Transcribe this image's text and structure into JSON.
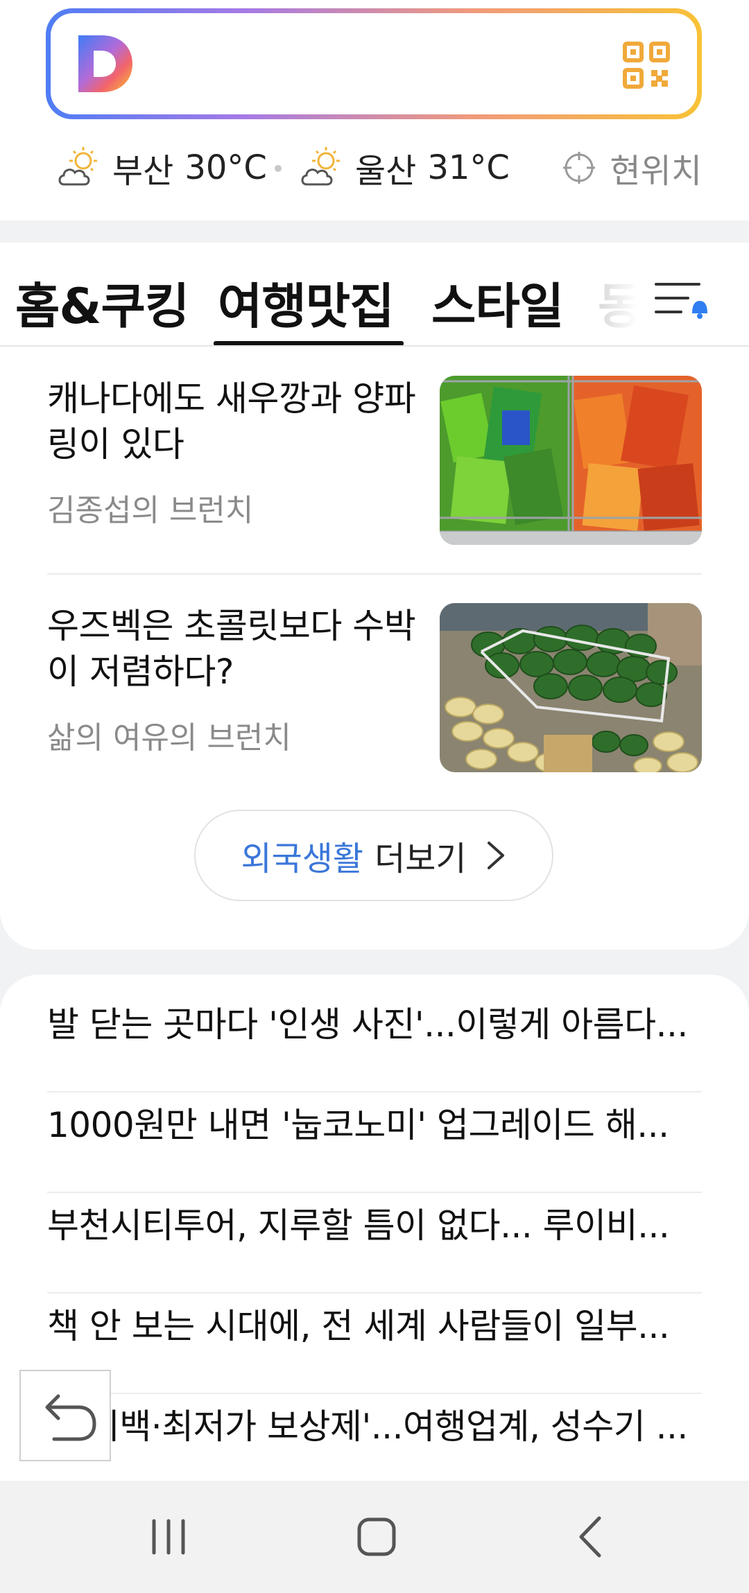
{
  "weather": [
    {
      "city": "부산",
      "temp": "30°C",
      "icon": "partly-cloudy-sun-icon"
    },
    {
      "city": "울산",
      "temp": "31°C",
      "icon": "partly-cloudy-sun-icon"
    }
  ],
  "location_label": "현위치",
  "tabs": [
    {
      "label": "홈&쿠킹",
      "active": false
    },
    {
      "label": "여행맛집",
      "active": true
    },
    {
      "label": "스타일",
      "active": false
    },
    {
      "label": "동",
      "active": false
    }
  ],
  "articles": [
    {
      "title": "캐나다에도 새우깡과 양파링이 있다",
      "source": "김종섭의 브런치",
      "thumb": "snack-bags-photo"
    },
    {
      "title": "우즈벡은 초콜릿보다 수박이 저렴하다?",
      "source": "삶의 여유의 브런치",
      "thumb": "watermelon-market-photo"
    }
  ],
  "more_button": {
    "category": "외국생활",
    "label": "더보기"
  },
  "news": [
    "발 닫는 곳마다 '인생 사진'...이렇게 아름다...",
    "1000원만 내면 '눕코노미' 업그레이드 해...",
    "부천시티투어, 지루할 틈이 없다... 루이비...",
    "책 안 보는 시대에, 전 세계 사람들이 일부...",
    "'페이백·최저가 보상제'...여행업계, 성수기 ..."
  ],
  "colors": {
    "accent_blue": "#3b77d9",
    "search_gradient": [
      "#4f7df5",
      "#a57ae6",
      "#f09a7c",
      "#f8c236"
    ],
    "qr_orange": "#f0a93a"
  }
}
